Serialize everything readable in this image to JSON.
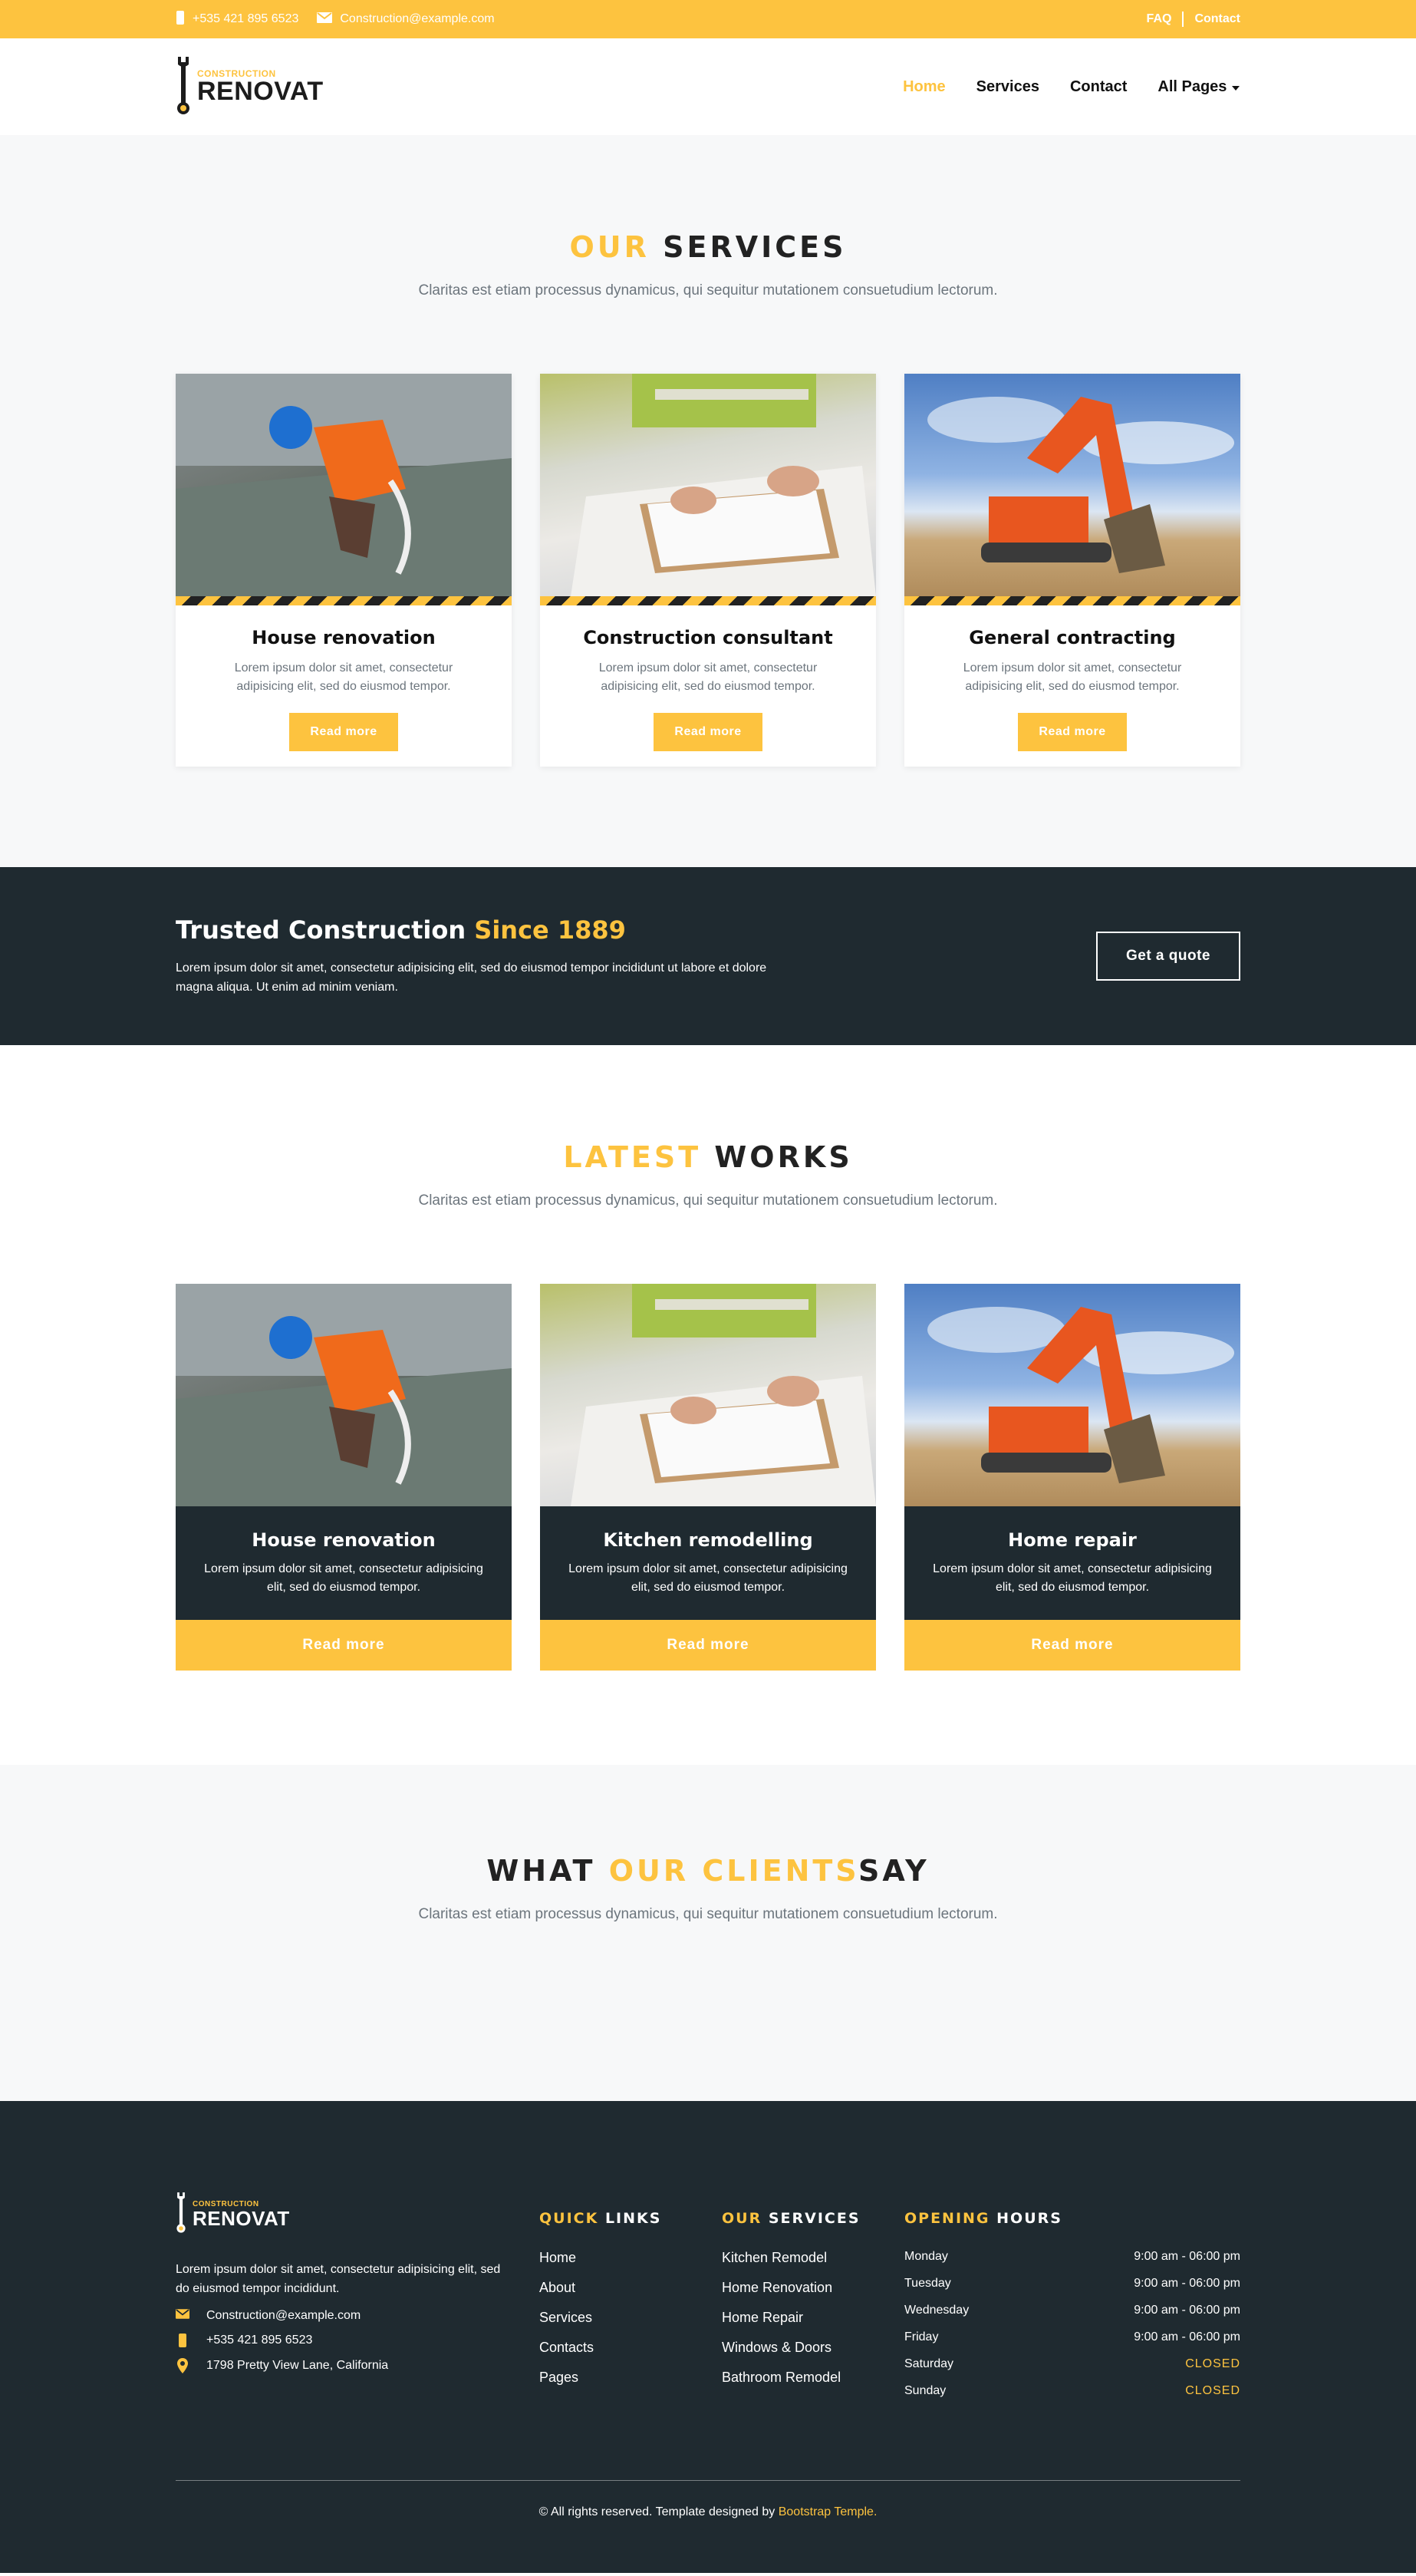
{
  "topbar": {
    "phone": "+535 421 895 6523",
    "email": "Construction@example.com",
    "faq": "FAQ",
    "contact": "Contact"
  },
  "brand": {
    "small": "CONSTRUCTION",
    "big": "RENOVAT"
  },
  "nav": {
    "home": "Home",
    "services": "Services",
    "contact": "Contact",
    "all_pages": "All Pages"
  },
  "services": {
    "title_accent": "OUR",
    "title_rest": "SERVICES",
    "subtitle": "Claritas est etiam processus dynamicus, qui sequitur mutationem consuetudium lectorum.",
    "cards": [
      {
        "title": "House renovation",
        "text": "Lorem ipsum dolor sit amet, consectetur adipisicing elit, sed do eiusmod tempor.",
        "button": "Read more"
      },
      {
        "title": "Construction consultant",
        "text": "Lorem ipsum dolor sit amet, consectetur adipisicing elit, sed do eiusmod tempor.",
        "button": "Read more"
      },
      {
        "title": "General contracting",
        "text": "Lorem ipsum dolor sit amet, consectetur adipisicing elit, sed do eiusmod tempor.",
        "button": "Read more"
      }
    ]
  },
  "banner": {
    "title": "Trusted Construction",
    "title_accent": "Since 1889",
    "text": "Lorem ipsum dolor sit amet, consectetur adipisicing elit, sed do eiusmod tempor incididunt ut labore et dolore magna aliqua. Ut enim ad minim veniam.",
    "button": "Get a quote"
  },
  "works": {
    "title_accent": "LATEST",
    "title_rest": "WORKS",
    "subtitle": "Claritas est etiam processus dynamicus, qui sequitur mutationem consuetudium lectorum.",
    "cards": [
      {
        "title": "House renovation",
        "text": "Lorem ipsum dolor sit amet, consectetur adipisicing elit, sed do eiusmod tempor.",
        "button": "Read more"
      },
      {
        "title": "Kitchen remodelling",
        "text": "Lorem ipsum dolor sit amet, consectetur adipisicing elit, sed do eiusmod tempor.",
        "button": "Read more"
      },
      {
        "title": "Home repair",
        "text": "Lorem ipsum dolor sit amet, consectetur adipisicing elit, sed do eiusmod tempor.",
        "button": "Read more"
      }
    ]
  },
  "clients": {
    "title_pre": "WHAT",
    "title_accent": "OUR CLIENTS",
    "title_rest": "SAY",
    "subtitle": "Claritas est etiam processus dynamicus, qui sequitur mutationem consuetudium lectorum."
  },
  "footer": {
    "desc": "Lorem ipsum dolor sit amet, consectetur adipisicing elit, sed do eiusmod tempor incididunt.",
    "email": "Construction@example.com",
    "phone": "+535 421 895 6523",
    "address": "1798 Pretty View Lane, California",
    "quick_accent": "QUICK",
    "quick_rest": "LINKS",
    "quick_links": [
      "Home",
      "About",
      "Services",
      "Contacts",
      "Pages"
    ],
    "services_accent": "OUR",
    "services_rest": "SERVICES",
    "services_links": [
      "Kitchen Remodel",
      "Home Renovation",
      "Home Repair",
      "Windows & Doors",
      "Bathroom Remodel"
    ],
    "hours_accent": "OPENING",
    "hours_rest": "HOURS",
    "hours": [
      {
        "day": "Monday",
        "time": "9:00 am - 06:00 pm"
      },
      {
        "day": "Tuesday",
        "time": "9:00 am - 06:00 pm"
      },
      {
        "day": "Wednesday",
        "time": "9:00 am - 06:00 pm"
      },
      {
        "day": "Friday",
        "time": "9:00 am - 06:00 pm"
      },
      {
        "day": "Saturday",
        "time": "CLOSED"
      },
      {
        "day": "Sunday",
        "time": "CLOSED"
      }
    ],
    "copyright": "© All rights reserved. Template designed by",
    "credit": "Bootstrap Temple."
  },
  "colors": {
    "accent": "#fdc33f",
    "dark": "#1f2a30",
    "light_bg": "#f7f8f9"
  }
}
